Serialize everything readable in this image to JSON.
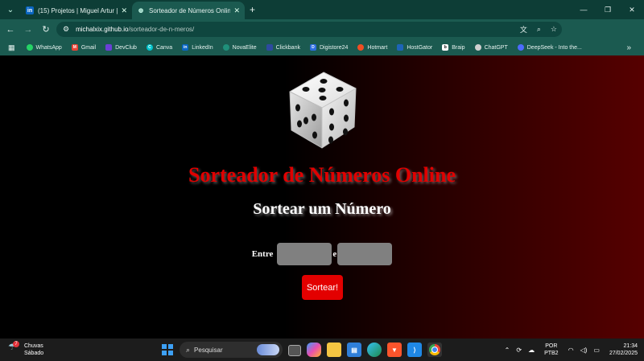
{
  "browser": {
    "tabs": [
      {
        "title": "(15) Projetos | Miguel Artur | Lin",
        "favicon": "linkedin-icon",
        "active": false
      },
      {
        "title": "Sorteador de Números Online",
        "favicon": "globe-icon",
        "active": true
      }
    ],
    "url_host": "michalxix.github.io",
    "url_path": "/sorteador-de-n-meros/",
    "bookmarks": [
      {
        "label": "WhatsApp",
        "icon": "whatsapp-icon",
        "color": "#25d366"
      },
      {
        "label": "Gmail",
        "icon": "gmail-icon",
        "color": "#ea4335"
      },
      {
        "label": "DevClub",
        "icon": "devclub-icon",
        "color": "#6b3fd6"
      },
      {
        "label": "Canva",
        "icon": "canva-icon",
        "color": "#00c4cc"
      },
      {
        "label": "LinkedIn",
        "icon": "linkedin-icon",
        "color": "#0a66c2"
      },
      {
        "label": "NovaElite",
        "icon": "novaelite-icon",
        "color": "#1f8f7a"
      },
      {
        "label": "Clickbank",
        "icon": "clickbank-icon",
        "color": "#2d4aa0"
      },
      {
        "label": "Digistore24",
        "icon": "digistore-icon",
        "color": "#2c6de0"
      },
      {
        "label": "Hotmart",
        "icon": "hotmart-icon",
        "color": "#f04e23"
      },
      {
        "label": "HostGator",
        "icon": "hostgator-icon",
        "color": "#1d64b8"
      },
      {
        "label": "Braip",
        "icon": "braip-icon",
        "color": "#ffffff"
      },
      {
        "label": "ChatGPT",
        "icon": "chatgpt-icon",
        "color": "#cfcfcf"
      },
      {
        "label": "DeepSeek - Into the...",
        "icon": "deepseek-icon",
        "color": "#4d6bfe"
      }
    ]
  },
  "page": {
    "title": "Sorteador de Números Online",
    "subtitle": "Sortear um Número",
    "label_between": "Entre",
    "label_and": "e",
    "min_value": "",
    "max_value": "",
    "button": "Sortear!",
    "colors": {
      "accent": "#e00000",
      "input": "#808080"
    }
  },
  "taskbar": {
    "weather_label": "Chuvas",
    "weather_sub": "Sábado",
    "weather_badge": "7",
    "search_placeholder": "Pesquisar",
    "language": "POR",
    "layout": "PTB2",
    "time": "21:34",
    "date": "27/02/2025"
  }
}
